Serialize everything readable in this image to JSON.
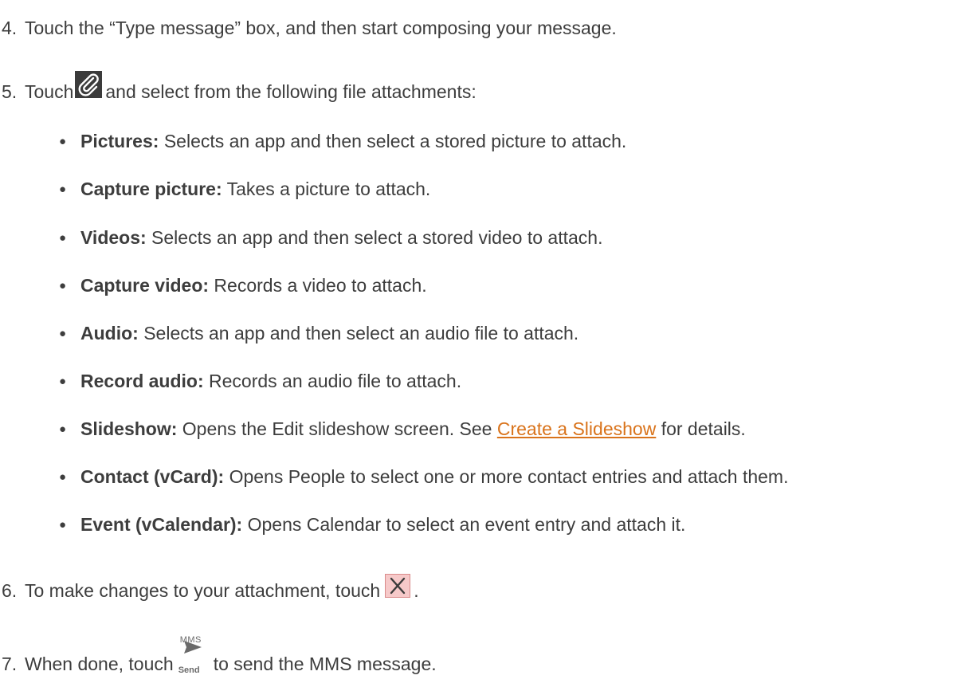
{
  "steps": {
    "s4": {
      "num": "4.",
      "text": "Touch the “Type message” box, and then start composing your message."
    },
    "s5": {
      "num": "5.",
      "before": "Touch",
      "after": "and select from the following file attachments:"
    },
    "s6": {
      "num": "6.",
      "before": "To make changes to your attachment, touch",
      "after": "."
    },
    "s7": {
      "num": "7.",
      "before": "When done, touch",
      "after": "to send the MMS message.",
      "icon_top": "MMS",
      "icon_bottom": "Send"
    }
  },
  "bullets": [
    {
      "label": "Pictures:",
      "text": "Selects an app and then select a stored picture to attach."
    },
    {
      "label": "Capture picture:",
      "text": "Takes a picture to attach."
    },
    {
      "label": "Videos:",
      "text": "Selects an app and then select a stored video to attach."
    },
    {
      "label": "Capture video:",
      "text": "Records a video to attach."
    },
    {
      "label": "Audio:",
      "text": "Selects an app and then select an audio file to attach."
    },
    {
      "label": "Record audio:",
      "text": "Records an audio file to attach."
    },
    {
      "label": "Slideshow:",
      "text": "Opens the Edit slideshow screen. See",
      "link": "Create a Slideshow",
      "after": "for details."
    },
    {
      "label": "Contact (vCard):",
      "text": "Opens People to select one or more contact entries and attach them."
    },
    {
      "label": "Event (vCalendar):",
      "text": "Opens Calendar to select an event entry and attach it."
    }
  ],
  "colors": {
    "text": "#3d3d3d",
    "link": "#d9731b",
    "icon_dark": "#3b3b3b",
    "close_bg": "#f6c9c9"
  },
  "icons": [
    "paperclip-icon",
    "close-icon",
    "send-icon"
  ]
}
